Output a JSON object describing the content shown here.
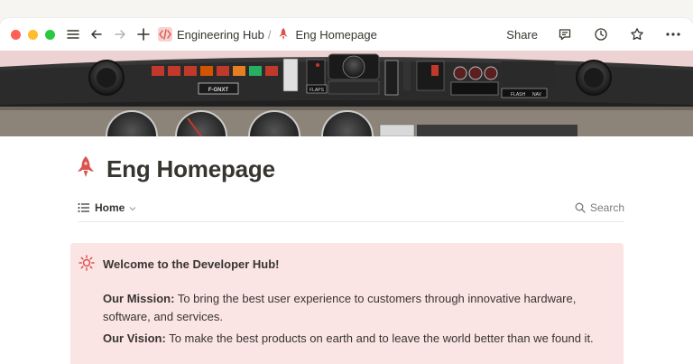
{
  "breadcrumb": {
    "parent": "Engineering Hub",
    "separator": "/",
    "current": "Eng Homepage",
    "parent_icon": "code-icon",
    "current_icon": "rocket-icon"
  },
  "toolbar": {
    "share_label": "Share"
  },
  "cover": {
    "description_icon": "aircraft-cockpit-panel",
    "labels": {
      "tail": "F-GNXT",
      "flaps": "FLAPS",
      "flash": "FLASH",
      "nav": "NAV"
    }
  },
  "page": {
    "title": "Eng Homepage",
    "icon": "rocket-icon"
  },
  "viewbar": {
    "view_label": "Home",
    "search_label": "Search"
  },
  "callout": {
    "icon": "sun-icon",
    "heading": "Welcome to the Developer Hub!",
    "mission_label": "Our Mission:",
    "mission_text": " To bring the best user experience to customers through innovative hardware,",
    "mission_text_2": "software, and services.",
    "vision_label": "Our Vision:",
    "vision_text": " To make the best products on earth and to leave the world better than we found it."
  },
  "colors": {
    "accent_red": "#d9534f",
    "callout_bg": "#fbe4e4",
    "text": "#37352f"
  }
}
